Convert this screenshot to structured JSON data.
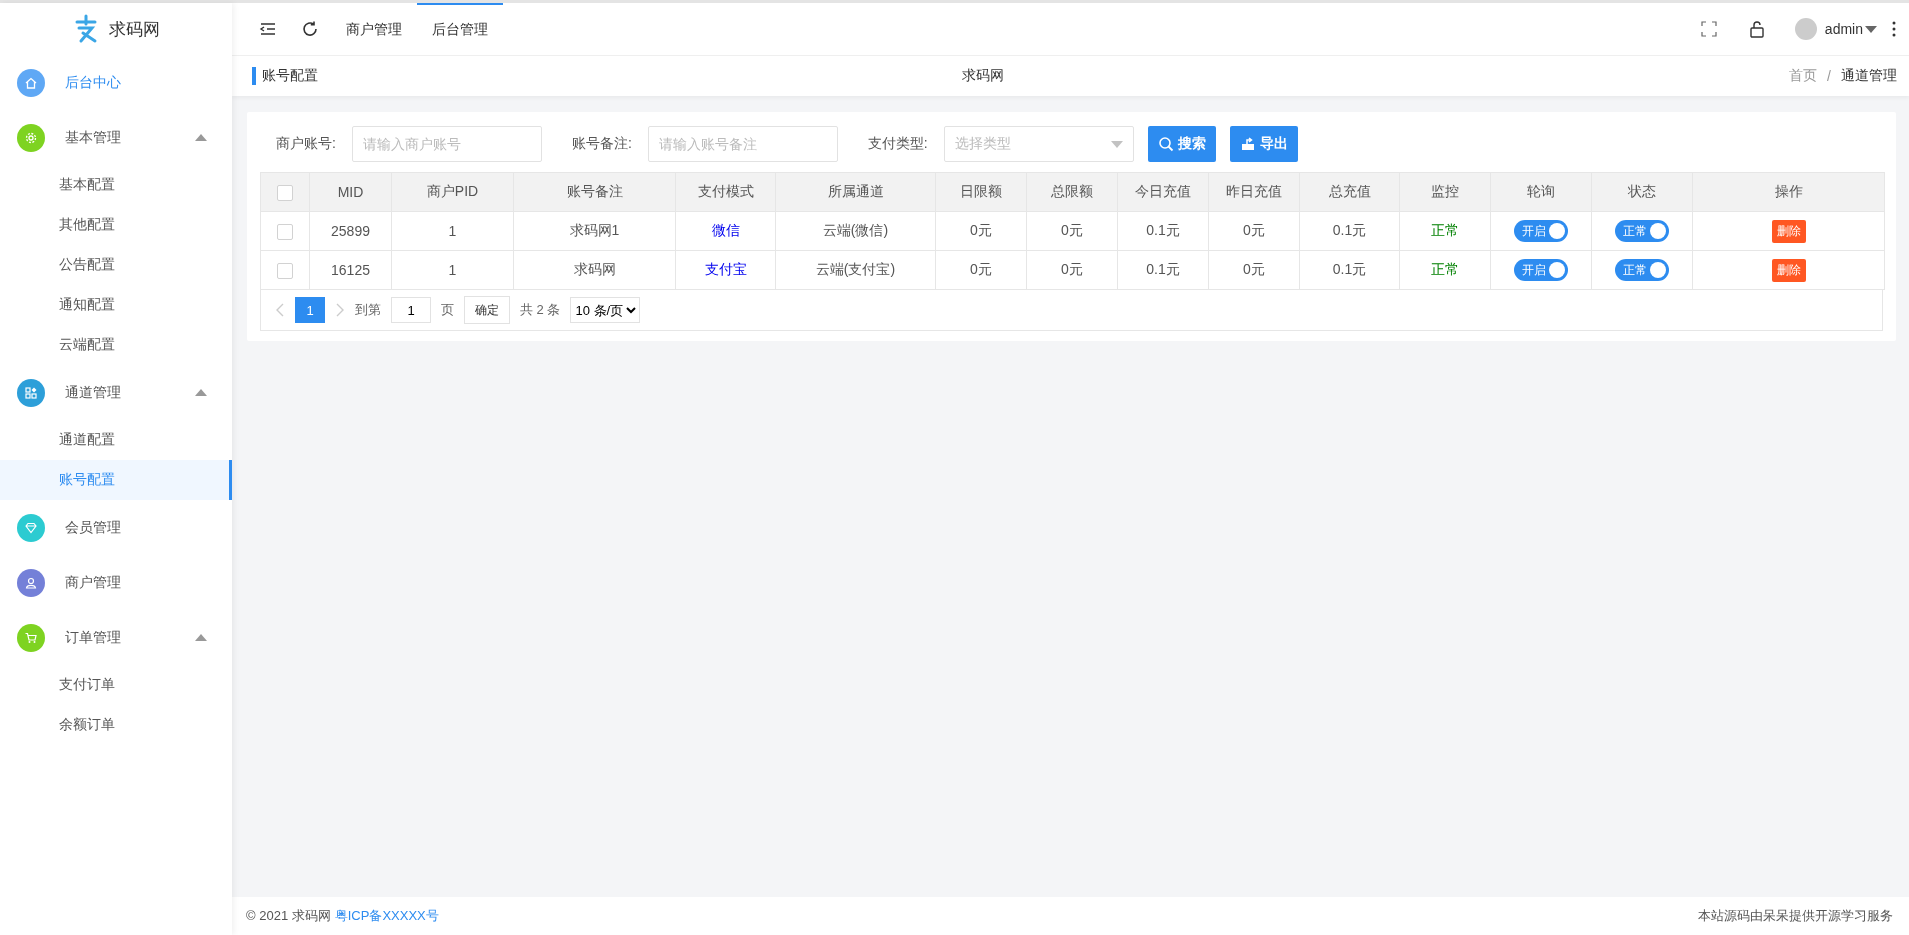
{
  "sidebar": {
    "logo": "求码网",
    "items": [
      {
        "label": "后台中心",
        "color": "#5fa8f5",
        "selected": true,
        "kind": "home"
      },
      {
        "label": "基本管理",
        "color": "#7ed321",
        "selected": false,
        "kind": "gear",
        "expanded": true,
        "children": [
          {
            "label": "基本配置",
            "selected": false
          },
          {
            "label": "其他配置",
            "selected": false
          },
          {
            "label": "公告配置",
            "selected": false
          },
          {
            "label": "通知配置",
            "selected": false
          },
          {
            "label": "云端配置",
            "selected": false
          }
        ]
      },
      {
        "label": "通道管理",
        "color": "#2d9fd9",
        "selected": false,
        "kind": "grid",
        "expanded": true,
        "children": [
          {
            "label": "通道配置",
            "selected": false
          },
          {
            "label": "账号配置",
            "selected": true
          }
        ]
      },
      {
        "label": "会员管理",
        "color": "#2ccbd1",
        "selected": false,
        "kind": "diamond"
      },
      {
        "label": "商户管理",
        "color": "#7480d8",
        "selected": false,
        "kind": "user"
      },
      {
        "label": "订单管理",
        "color": "#7ed321",
        "selected": false,
        "kind": "cart",
        "expanded": true,
        "children": [
          {
            "label": "支付订单",
            "selected": false
          },
          {
            "label": "余额订单",
            "selected": false
          }
        ]
      }
    ]
  },
  "topbar": {
    "tabs": [
      {
        "label": "商户管理",
        "selected": false
      },
      {
        "label": "后台管理",
        "selected": true
      }
    ],
    "user": "admin"
  },
  "subheader": {
    "title": "账号配置",
    "site": "求码网",
    "breadcrumb": [
      "首页",
      "通道管理"
    ],
    "breadcrumb_separator": "/"
  },
  "filters": [
    {
      "label": "商户账号:",
      "placeholder": "请输入商户账号",
      "kind": "input"
    },
    {
      "label": "账号备注:",
      "placeholder": "请输入账号备注",
      "kind": "input"
    },
    {
      "label": "支付类型:",
      "placeholder": "选择类型",
      "kind": "select"
    }
  ],
  "buttons": [
    {
      "label": "搜索",
      "kind": "search"
    },
    {
      "label": "导出",
      "kind": "export"
    }
  ],
  "table": {
    "header_checked": false,
    "columns": [
      "MID",
      "商户PID",
      "账号备注",
      "支付模式",
      "所属通道",
      "日限额",
      "总限额",
      "今日充值",
      "昨日充值",
      "总充值",
      "监控",
      "轮询",
      "状态",
      "操作"
    ],
    "rows": [
      {
        "checked": false,
        "mid": "25899",
        "pid": "1",
        "note": "求码网1",
        "mode": "微信",
        "channel": "云端(微信)",
        "day_limit": "0元",
        "total_limit": "0元",
        "today": "0.1元",
        "yesterday": "0元",
        "total": "0.1元",
        "monitor": "正常",
        "polling": {
          "label": "开启",
          "on": true
        },
        "status": {
          "label": "正常",
          "on": true
        },
        "action": "删除"
      },
      {
        "checked": false,
        "mid": "16125",
        "pid": "1",
        "note": "求码网",
        "mode": "支付宝",
        "channel": "云端(支付宝)",
        "day_limit": "0元",
        "total_limit": "0元",
        "today": "0.1元",
        "yesterday": "0元",
        "total": "0.1元",
        "monitor": "正常",
        "polling": {
          "label": "开启",
          "on": true
        },
        "status": {
          "label": "正常",
          "on": true
        },
        "action": "删除"
      }
    ]
  },
  "pagination": {
    "pages": [
      {
        "label": "1",
        "selected": true
      }
    ],
    "goto_label": "到第",
    "goto_value": "1",
    "page_unit": "页",
    "confirm": "确定",
    "total": "共 2 条",
    "page_size": "10 条/页"
  },
  "footer": {
    "copyright": "© 2021 求码网",
    "icp": "粤ICP备XXXXX号",
    "right": "本站源码由呆呆提供开源学习服务"
  }
}
